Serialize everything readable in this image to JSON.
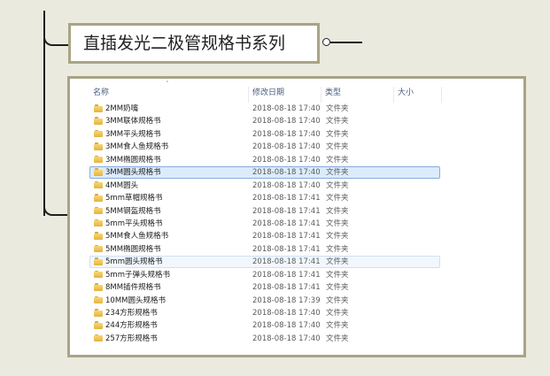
{
  "title": "直插发光二极管规格书系列",
  "explorer": {
    "columns": {
      "name": "名称",
      "date": "修改日期",
      "type": "类型",
      "size": "大小"
    },
    "rows": [
      {
        "name": "2MM奶嘴",
        "date": "2018-08-18 17:40",
        "type": "文件夹"
      },
      {
        "name": "3MM联体规格书",
        "date": "2018-08-18 17:40",
        "type": "文件夹"
      },
      {
        "name": "3MM平头规格书",
        "date": "2018-08-18 17:40",
        "type": "文件夹"
      },
      {
        "name": "3MM食人鱼规格书",
        "date": "2018-08-18 17:40",
        "type": "文件夹"
      },
      {
        "name": "3MM椭圆规格书",
        "date": "2018-08-18 17:40",
        "type": "文件夹"
      },
      {
        "name": "3MM圆头规格书",
        "date": "2018-08-18 17:40",
        "type": "文件夹",
        "state": "selected"
      },
      {
        "name": "4MM圆头",
        "date": "2018-08-18 17:40",
        "type": "文件夹"
      },
      {
        "name": "5mm草帽规格书",
        "date": "2018-08-18 17:41",
        "type": "文件夹"
      },
      {
        "name": "5MM钢盔规格书",
        "date": "2018-08-18 17:41",
        "type": "文件夹"
      },
      {
        "name": "5mm平头规格书",
        "date": "2018-08-18 17:41",
        "type": "文件夹"
      },
      {
        "name": "5MM食人鱼规格书",
        "date": "2018-08-18 17:41",
        "type": "文件夹"
      },
      {
        "name": "5MM椭圆规格书",
        "date": "2018-08-18 17:41",
        "type": "文件夹"
      },
      {
        "name": "5mm圆头规格书",
        "date": "2018-08-18 17:41",
        "type": "文件夹",
        "state": "hover"
      },
      {
        "name": "5mm子弹头规格书",
        "date": "2018-08-18 17:41",
        "type": "文件夹"
      },
      {
        "name": "8MM插件规格书",
        "date": "2018-08-18 17:41",
        "type": "文件夹"
      },
      {
        "name": "10MM圆头规格书",
        "date": "2018-08-18 17:39",
        "type": "文件夹"
      },
      {
        "name": "234方形规格书",
        "date": "2018-08-18 17:40",
        "type": "文件夹"
      },
      {
        "name": "244方形规格书",
        "date": "2018-08-18 17:40",
        "type": "文件夹"
      },
      {
        "name": "257方形规格书",
        "date": "2018-08-18 17:40",
        "type": "文件夹"
      }
    ]
  },
  "colors": {
    "background": "#ebeadf",
    "frame": "#a8a486",
    "selection": "#dcebfc",
    "selection_border": "#84acdd",
    "folder": "#e3b43f"
  },
  "icons": {
    "folder": "folder-icon",
    "connector": "connector-knob-icon"
  }
}
